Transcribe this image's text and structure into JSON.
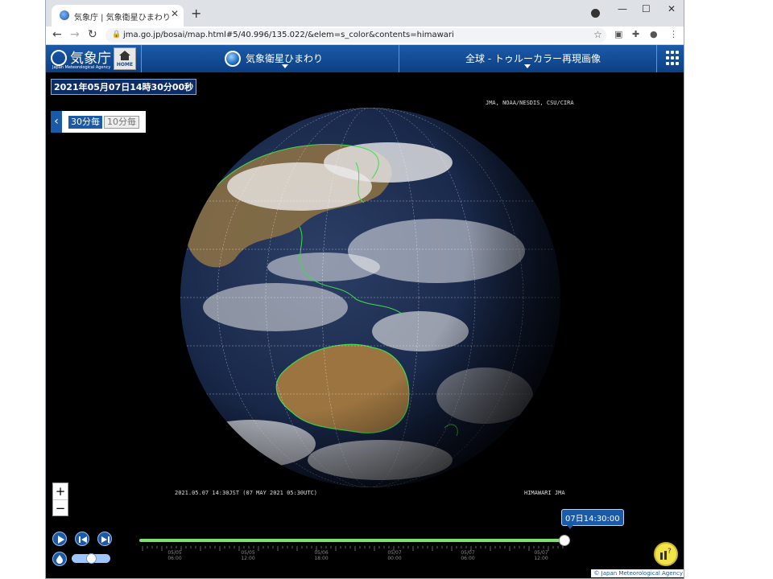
{
  "browser": {
    "tab_title": "気象庁 | 気象衛星ひまわり",
    "new_tab": "+",
    "url": "jma.go.jp/bosai/map.html#5/40.996/135.022/&elem=s_color&contents=himawari"
  },
  "header": {
    "logo_text": "気象庁",
    "logo_sub": "Japan Meteorological Agency",
    "home_label": "HOME",
    "menu_center": "気象衛星ひまわり",
    "menu_right": "全球 - トゥルーカラー再現画像"
  },
  "map": {
    "datetime": "2021年05月07日14時30分00秒",
    "interval_30": "30分毎",
    "interval_10": "10分毎",
    "credit": "JMA, NOAA/NESDIS, CSU/CIRA",
    "overlay_time": "2021.05.07 14:30JST (07 MAY 2021 05:30UTC)",
    "overlay_sat": "HIMAWARI JMA",
    "zoom_in": "+",
    "zoom_out": "−",
    "time_tag": "07日14:30:00",
    "copyright": "© Japan Meteorological Agency"
  },
  "timeline": {
    "progress": 1.0,
    "labels": [
      {
        "date": "05/05",
        "time": "06:00"
      },
      {
        "date": "05/05",
        "time": "12:00"
      },
      {
        "date": "05/06",
        "time": "18:00"
      },
      {
        "date": "05/07",
        "time": "00:00"
      },
      {
        "date": "05/07",
        "time": "06:00"
      },
      {
        "date": "05/07",
        "time": "12:00"
      }
    ]
  },
  "colors": {
    "brand_blue": "#1b5aa8",
    "slider_green": "#7be36c",
    "coastline_green": "#3ddc4a",
    "help_yellow": "#f2e34a"
  },
  "icons": [
    "favicon-icon",
    "close-icon",
    "back-icon",
    "forward-icon",
    "reload-icon",
    "lock-icon",
    "star-icon",
    "extension-icon",
    "profile-icon",
    "kebab-menu-icon",
    "home-icon",
    "satellite-icon",
    "grid-menu-icon",
    "chevron-left-icon",
    "play-icon",
    "step-back-icon",
    "step-forward-icon",
    "water-drop-icon",
    "help-icon"
  ]
}
